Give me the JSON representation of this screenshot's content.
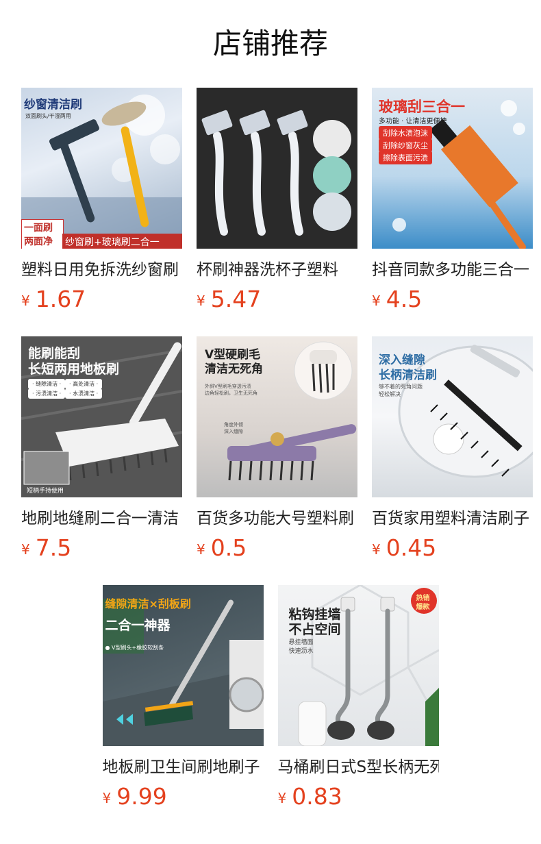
{
  "page": {
    "title": "店铺推荐",
    "currency": "¥",
    "price_color": "#e4411e"
  },
  "products": [
    {
      "name": "塑料日用免拆洗纱窗刷",
      "price": "1.67",
      "thumb": {
        "title": "纱窗清洁刷",
        "subtitle": "双面刷头/干湿两用",
        "badge_line1": "一面刷",
        "badge_line2": "两面净",
        "banner": "纱窗刷+玻璃刷二合一"
      }
    },
    {
      "name": "杯刷神器洗杯子塑料",
      "price": "5.47",
      "thumb": {}
    },
    {
      "name": "抖音同款多功能三合一",
      "price": "4.5",
      "thumb": {
        "title": "玻璃刮三合一",
        "subtitle": "多功能 · 让清洁更便捷",
        "tags": [
          "刮除水渍泡沫",
          "刮除纱窗灰尘",
          "擦除表面污渍"
        ]
      }
    },
    {
      "name": "地刷地缝刷二合一清洁",
      "price": "7.5",
      "thumb": {
        "title_line1": "能刷能刮",
        "title_line2": "长短两用地板刷",
        "chips": [
          "· 缝隙清洁 ·",
          "· 高处清洁 ·",
          "· 污渍清洁 ·",
          "· 水渍清洁 ·"
        ],
        "caption": "短柄手持使用"
      }
    },
    {
      "name": "百货多功能大号塑料刷",
      "price": "0.5",
      "thumb": {
        "title_line1": "V型硬刷毛",
        "title_line2": "清洁无死角",
        "desc_line1": "外斜V型刷毛穿透污渍",
        "desc_line2": "边角轻松刷，卫生无死角",
        "side_line1": "角度外倾",
        "side_line2": "深入缝隙"
      }
    },
    {
      "name": "百货家用塑料清洁刷子",
      "price": "0.45",
      "thumb": {
        "title_line1": "深入缝隙",
        "title_line2": "长柄清洁刷",
        "desc_line1": "够不着的死角问题",
        "desc_line2": "轻松解决"
      }
    },
    {
      "name": "地板刷卫生间刷地刷子",
      "price": "9.99",
      "thumb": {
        "title": "缝隙清洁×刮板刷",
        "subtitle": "二合一神器",
        "desc": "● V型刷头+橡胶软刮条"
      }
    },
    {
      "name": "马桶刷日式S型长柄无死角",
      "price": "0.83",
      "thumb": {
        "title_line1": "粘钩挂墙",
        "title_line2": "不占空间",
        "desc_line1": "悬挂墙面",
        "desc_line2": "快速沥水",
        "badge_line1": "热销",
        "badge_line2": "爆款"
      }
    }
  ]
}
